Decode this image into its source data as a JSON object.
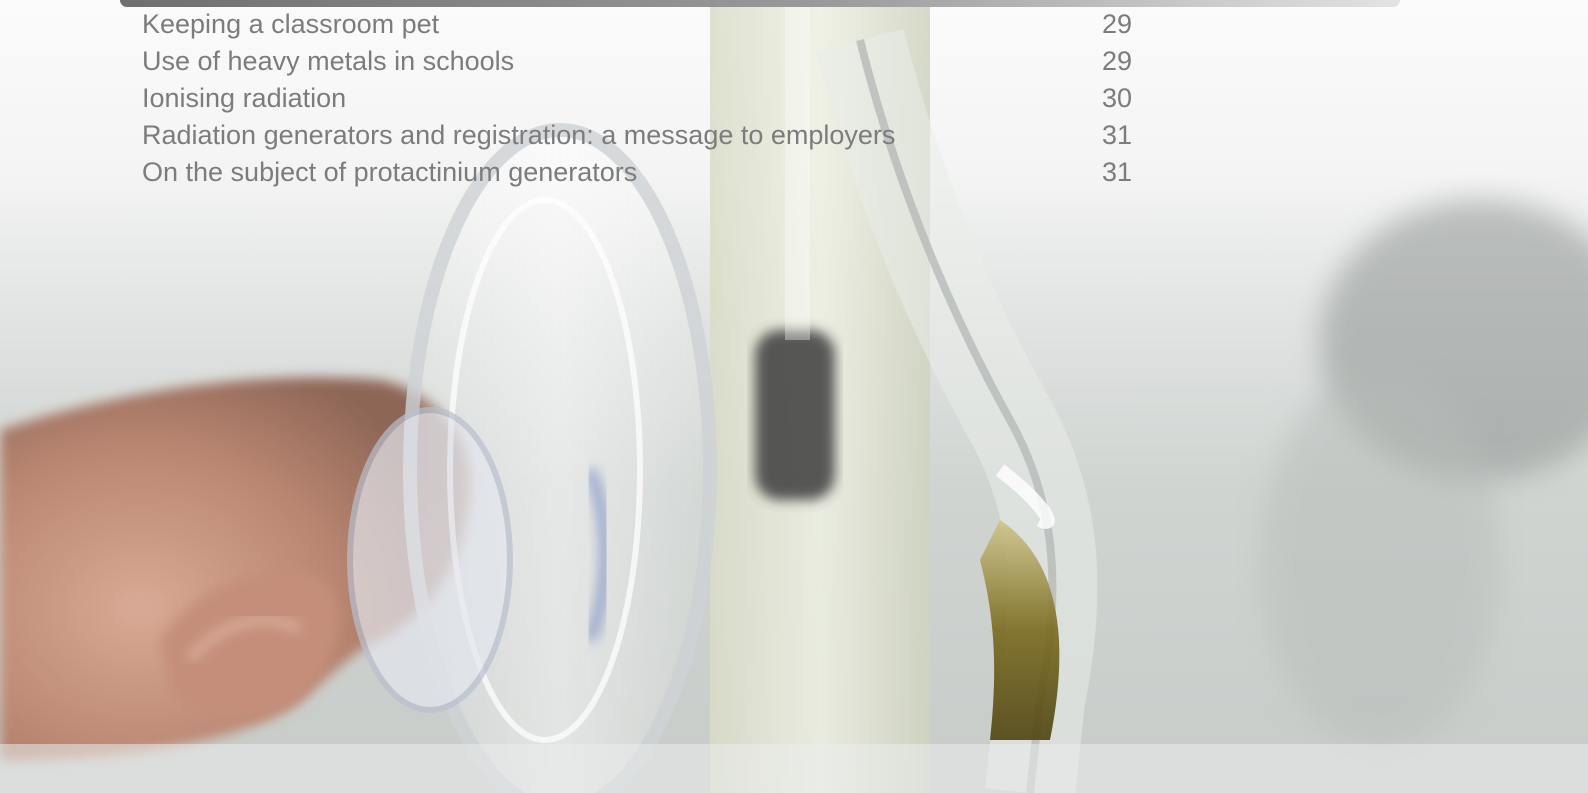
{
  "toc": {
    "entries": [
      {
        "title": "Keeping a classroom pet",
        "page": "29"
      },
      {
        "title": "Use of heavy metals in schools",
        "page": "29"
      },
      {
        "title": "Ionising radiation",
        "page": "30"
      },
      {
        "title": "Radiation generators and registration: a message to employers",
        "page": "31"
      },
      {
        "title": "On the subject of protactinium generators",
        "page": "31"
      }
    ]
  },
  "photo": {
    "subject": "hand holding laboratory glassware with amber liquid in a bent tube",
    "liquid_color": "#6b5a14",
    "skin_color": "#c99b86"
  }
}
